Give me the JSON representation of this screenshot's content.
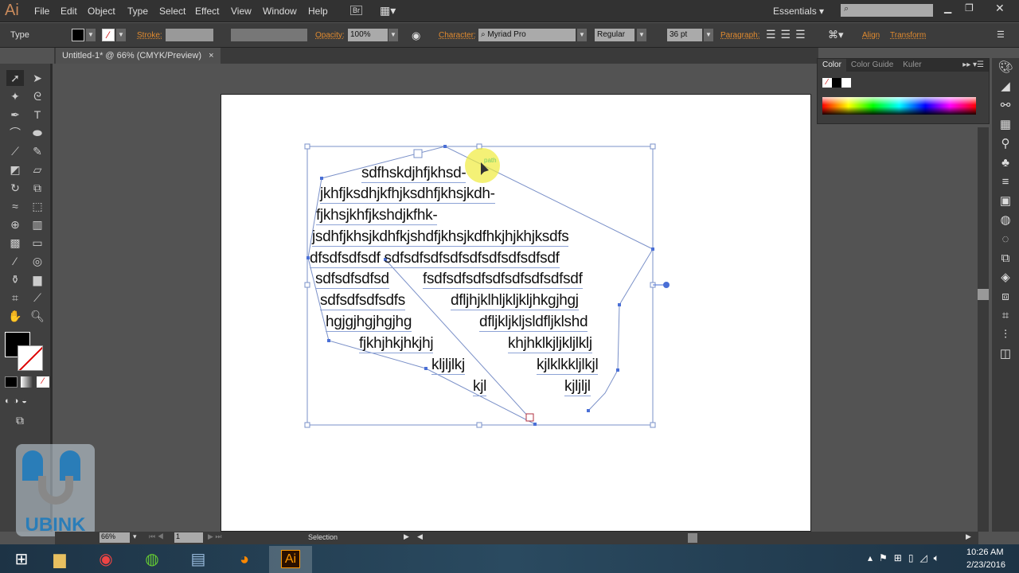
{
  "app": {
    "logo": "Ai",
    "menu": [
      "File",
      "Edit",
      "Object",
      "Type",
      "Select",
      "Effect",
      "View",
      "Window",
      "Help"
    ],
    "bridge": "Br",
    "workspace": "Essentials",
    "search_placeholder": ""
  },
  "control": {
    "tool_name": "Type",
    "stroke_label": "Stroke:",
    "opacity_label": "Opacity:",
    "opacity": "100%",
    "character_label": "Character:",
    "font": "Myriad Pro",
    "style": "Regular",
    "size": "36 pt",
    "paragraph_label": "Paragraph:",
    "align_label": "Align",
    "transform_label": "Transform"
  },
  "document": {
    "tab": "Untitled-1* @ 66% (CMYK/Preview)",
    "close": "×"
  },
  "cursor_hint": "path",
  "artwork_lines": [
    "sdfhskdjhfjkhsd-",
    "jkhfjksdhjkfhjksdhfjkhsjkdh-",
    "fjkhsjkhfjkshdjkfhk-",
    "jsdhfjkhsjkdhfkjshdfjkhsjkdfhkjhjkhjksdfs",
    "dfsdfsdfsdf sdfsdfsdfsdfsdfsdfsdfsdfsdf",
    "sdfsdfsdfsd",
    "fsdfsdfsdfsdfsdfsdfsdfsdf",
    "sdfsdfsdfsdfs",
    "dfljhjklhljkljkljhkgjhgj",
    "hgjgjhgjhgjhg",
    "dfljkljkljsldfljklshd",
    "fjkhjhkjhkjhj",
    "khjhklkjljkljlklj",
    "kljljlkj",
    "kjlklkkljlkjl",
    "kjl",
    "kjljljl"
  ],
  "color_panel": {
    "tabs": [
      "Color",
      "Color Guide",
      "Kuler"
    ]
  },
  "status": {
    "zoom": "66%",
    "page": "1",
    "tool": "Selection"
  },
  "watermark": "UBINK",
  "taskbar": {
    "time": "10:26 AM",
    "date": "2/23/2016",
    "apps": [
      "file-explorer",
      "chrome",
      "utorrent",
      "calculator",
      "firefox",
      "illustrator"
    ]
  },
  "colors": {
    "accent": "#e08a2f",
    "selection": "#4a6fd6"
  }
}
